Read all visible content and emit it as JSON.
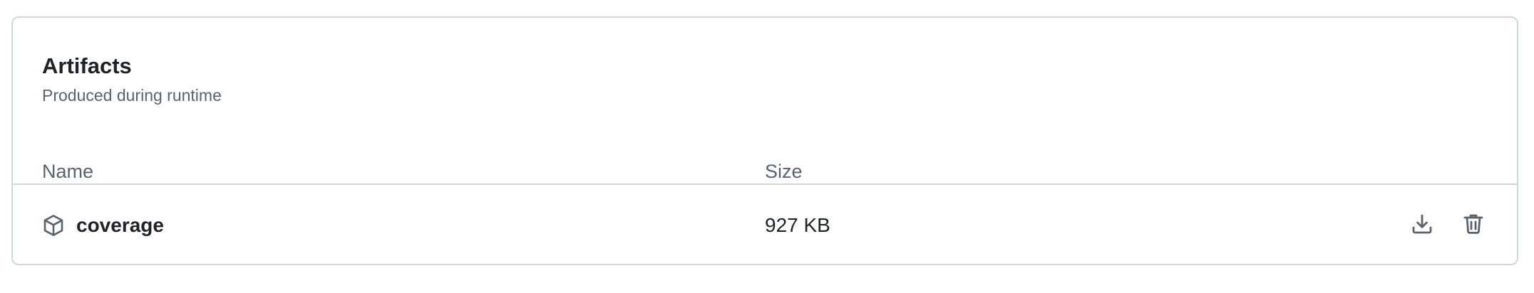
{
  "artifacts_panel": {
    "title": "Artifacts",
    "subtitle": "Produced during runtime",
    "columns": {
      "name": "Name",
      "size": "Size"
    },
    "rows": [
      {
        "icon": "package-icon",
        "name": "coverage",
        "size": "927 KB",
        "actions": [
          "download-icon",
          "trash-icon"
        ]
      }
    ]
  },
  "colors": {
    "text_primary": "#1f2328",
    "text_muted": "#59636e",
    "border": "#d0d7de"
  }
}
